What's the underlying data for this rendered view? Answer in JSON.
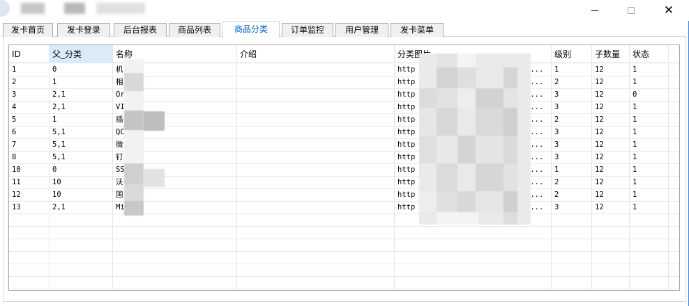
{
  "window": {
    "minimize_glyph": "—",
    "maximize_glyph": "☐",
    "close_glyph": "✕"
  },
  "tabs": [
    {
      "label": "发卡首页",
      "active": false
    },
    {
      "label": "发卡登录",
      "active": false
    },
    {
      "label": "后台报表",
      "active": false
    },
    {
      "label": "商品列表",
      "active": false
    },
    {
      "label": "商品分类",
      "active": true
    },
    {
      "label": "订单监控",
      "active": false
    },
    {
      "label": "用户管理",
      "active": false
    },
    {
      "label": "发卡菜单",
      "active": false
    }
  ],
  "table": {
    "columns": [
      "ID",
      "父_分类",
      "名称",
      "介绍",
      "分类图片",
      "级别",
      "子数量",
      "状态"
    ],
    "selected_column": "父_分类",
    "rows": [
      {
        "id": "1",
        "parent": "0",
        "name": "机",
        "intro": "",
        "image": "http",
        "image_tail": "/...",
        "level": "1",
        "count": "12",
        "status": "1"
      },
      {
        "id": "2",
        "parent": "1",
        "name": "相",
        "intro": "",
        "image": "http",
        "image_tail": "/...",
        "level": "2",
        "count": "12",
        "status": "1"
      },
      {
        "id": "3",
        "parent": "2,1",
        "name": "Or",
        "intro": "",
        "image": "http",
        "image_tail": "/...",
        "level": "3",
        "count": "12",
        "status": "0"
      },
      {
        "id": "4",
        "parent": "2,1",
        "name": "VI",
        "intro": "",
        "image": "http",
        "image_tail": "/...",
        "level": "3",
        "count": "12",
        "status": "1"
      },
      {
        "id": "5",
        "parent": "1",
        "name": "插",
        "intro": "",
        "image": "http",
        "image_tail": "/...",
        "level": "2",
        "count": "12",
        "status": "1"
      },
      {
        "id": "6",
        "parent": "5,1",
        "name": "QC",
        "intro": "",
        "image": "http",
        "image_tail": "/...",
        "level": "3",
        "count": "12",
        "status": "1"
      },
      {
        "id": "7",
        "parent": "5,1",
        "name": "微",
        "intro": "",
        "image": "http",
        "image_tail": "/...",
        "level": "3",
        "count": "12",
        "status": "1"
      },
      {
        "id": "8",
        "parent": "5,1",
        "name": "钉",
        "intro": "",
        "image": "http",
        "image_tail": "/...",
        "level": "3",
        "count": "12",
        "status": "1"
      },
      {
        "id": "10",
        "parent": "0",
        "name": "SS",
        "intro": "",
        "image": "http",
        "image_tail": "/...",
        "level": "1",
        "count": "12",
        "status": "1"
      },
      {
        "id": "11",
        "parent": "10",
        "name": "沃",
        "intro": "",
        "image": "http",
        "image_tail": "/...",
        "level": "2",
        "count": "12",
        "status": "1"
      },
      {
        "id": "12",
        "parent": "10",
        "name": "国",
        "intro": "",
        "image": "http",
        "image_tail": "/...",
        "level": "2",
        "count": "12",
        "status": "1"
      },
      {
        "id": "13",
        "parent": "2,1",
        "name": "Mi",
        "intro": "",
        "image": "http",
        "image_tail": "/...",
        "level": "3",
        "count": "12",
        "status": "1"
      }
    ]
  },
  "colors": {
    "active_tab_text": "#0060c0",
    "selected_header_bg": "#d9ebf9",
    "window_border": "#3c7fd6"
  }
}
